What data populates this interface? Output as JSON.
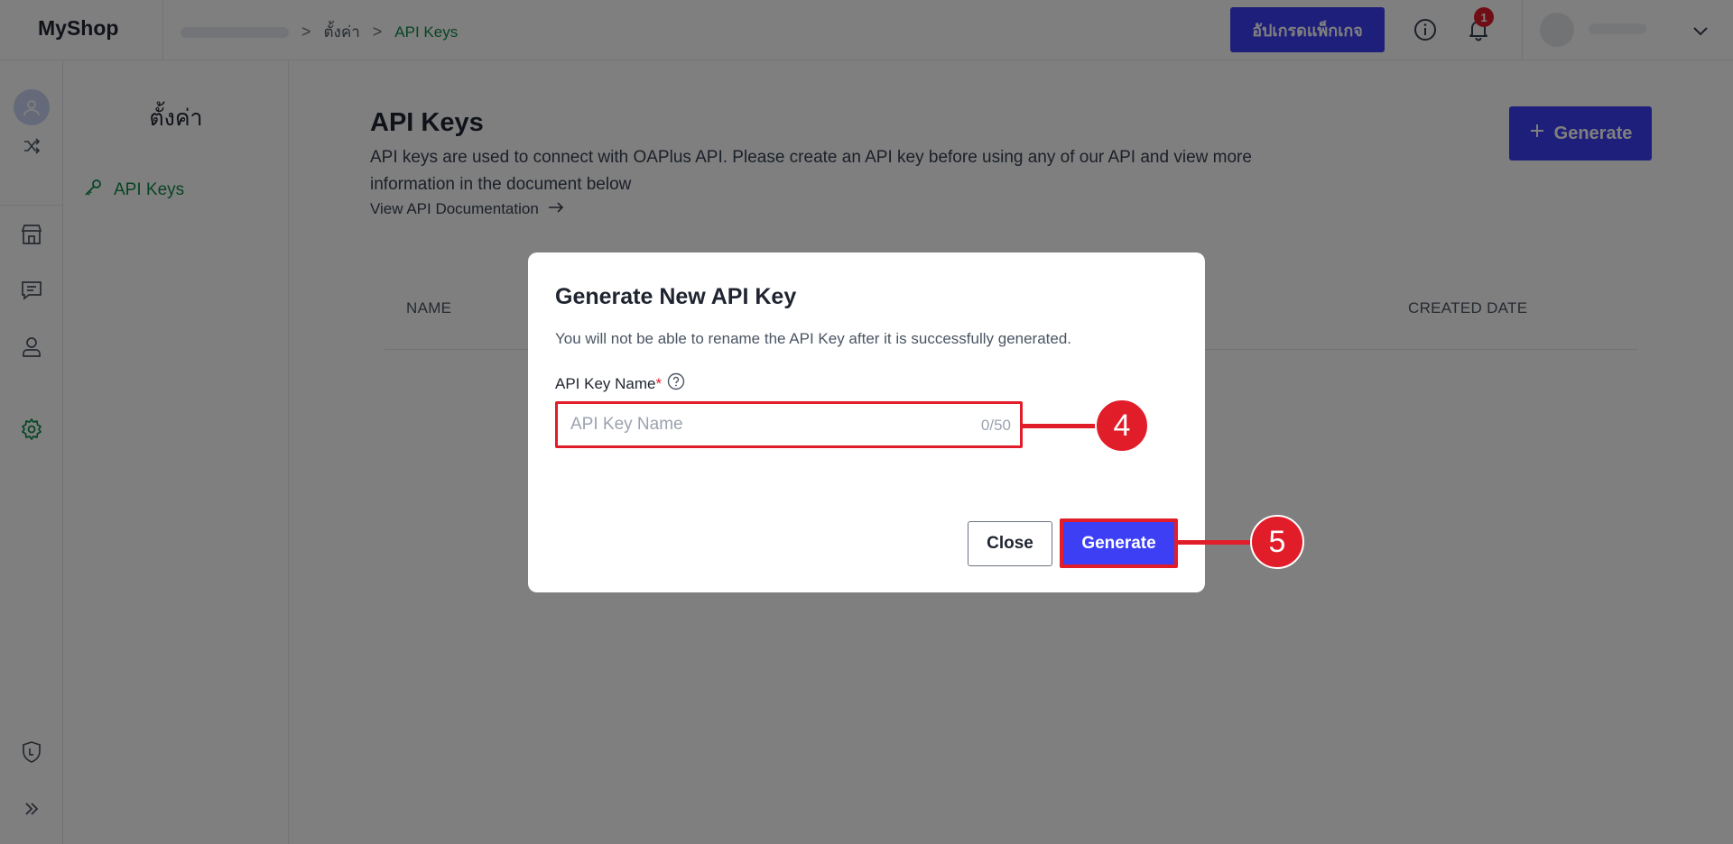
{
  "app": {
    "logo": "MyShop"
  },
  "breadcrumb": {
    "current_section": "ตั้งค่า",
    "current_page": "API Keys",
    "separator": ">"
  },
  "topbar": {
    "upgrade_label": "อัปเกรดแพ็กเกจ",
    "notification_count": "1"
  },
  "settings_sidebar": {
    "title": "ตั้งค่า",
    "item_label": "API Keys"
  },
  "main": {
    "title": "API Keys",
    "description": "API keys are used to connect with OAPlus API. Please create an API key before using any of our API and view more information in the document below",
    "doc_link": "View API Documentation",
    "generate_label": "Generate",
    "table_headers": {
      "name": "NAME",
      "created_date": "CREATED DATE"
    }
  },
  "modal": {
    "title": "Generate New API Key",
    "description": "You will not be able to rename the API Key after it is successfully generated.",
    "field_label": "API Key Name",
    "required_mark": "*",
    "placeholder": "API Key Name",
    "counter": "0/50",
    "close_label": "Close",
    "generate_label": "Generate"
  },
  "annotations": {
    "step_input": "4",
    "step_button": "5"
  },
  "colors": {
    "accent": "#3d3ff5",
    "active_green": "#0f8a4a",
    "highlight_red": "#e11d2a"
  }
}
